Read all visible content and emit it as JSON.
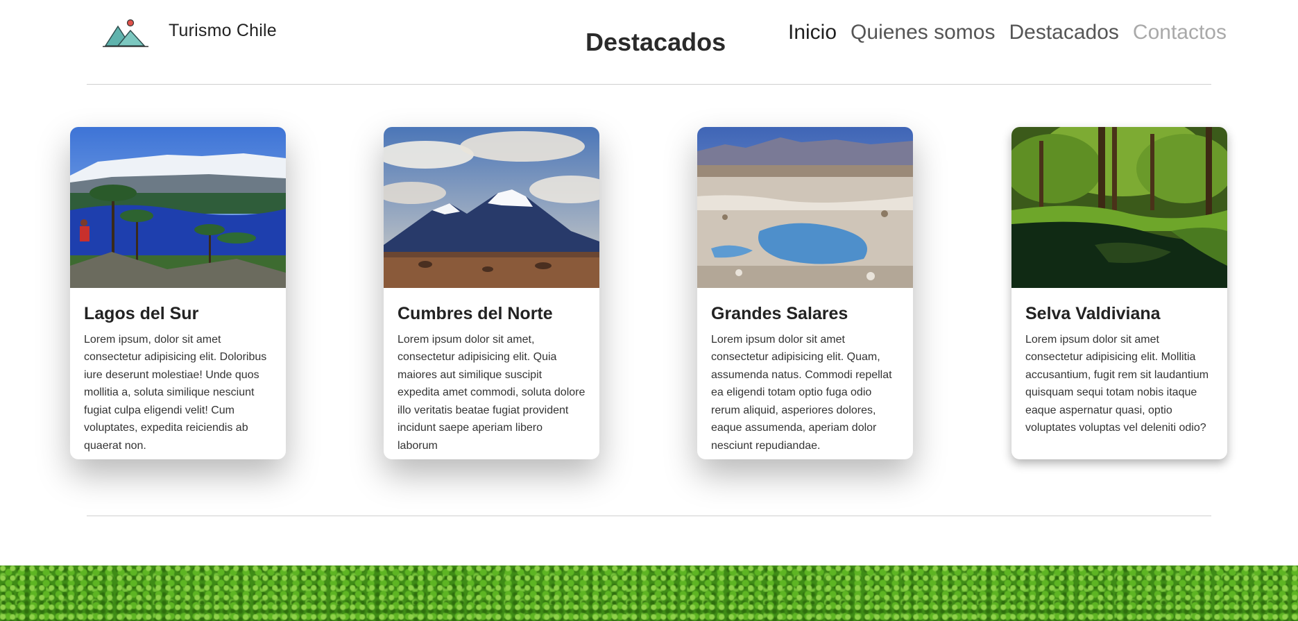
{
  "header": {
    "brand": "Turismo Chile",
    "page_title": "Destacados",
    "nav": [
      {
        "label": "Inicio",
        "state": "active"
      },
      {
        "label": "Quienes somos",
        "state": "normal"
      },
      {
        "label": "Destacados",
        "state": "normal"
      },
      {
        "label": "Contactos",
        "state": "muted"
      }
    ]
  },
  "cards": [
    {
      "title": "Lagos del Sur",
      "text": "Lorem ipsum, dolor sit amet consectetur adipisicing elit. Doloribus iure deserunt molestiae! Unde quos mollitia a, soluta similique nesciunt fugiat culpa eligendi velit! Cum voluptates, expedita reiciendis ab quaerat non."
    },
    {
      "title": "Cumbres del Norte",
      "text": "Lorem ipsum dolor sit amet, consectetur adipisicing elit. Quia maiores aut similique suscipit expedita amet commodi, soluta dolore illo veritatis beatae fugiat provident incidunt saepe aperiam libero laborum"
    },
    {
      "title": "Grandes Salares",
      "text": "Lorem ipsum dolor sit amet consectetur adipisicing elit. Quam, assumenda natus. Commodi repellat ea eligendi totam optio fuga odio rerum aliquid, asperiores dolores, eaque assumenda, aperiam dolor nesciunt repudiandae."
    },
    {
      "title": "Selva Valdiviana",
      "text": "Lorem ipsum dolor sit amet consectetur adipisicing elit. Mollitia accusantium, fugit rem sit laudantium quisquam sequi totam nobis itaque eaque aspernatur quasi, optio voluptates voluptas vel deleniti odio?"
    }
  ],
  "colors": {
    "nav_active": "#1f1f1f",
    "nav_normal": "#555555",
    "nav_muted": "#a9a9a9",
    "divider": "#cfcfcf",
    "footer_grass": "#3f8c16"
  }
}
